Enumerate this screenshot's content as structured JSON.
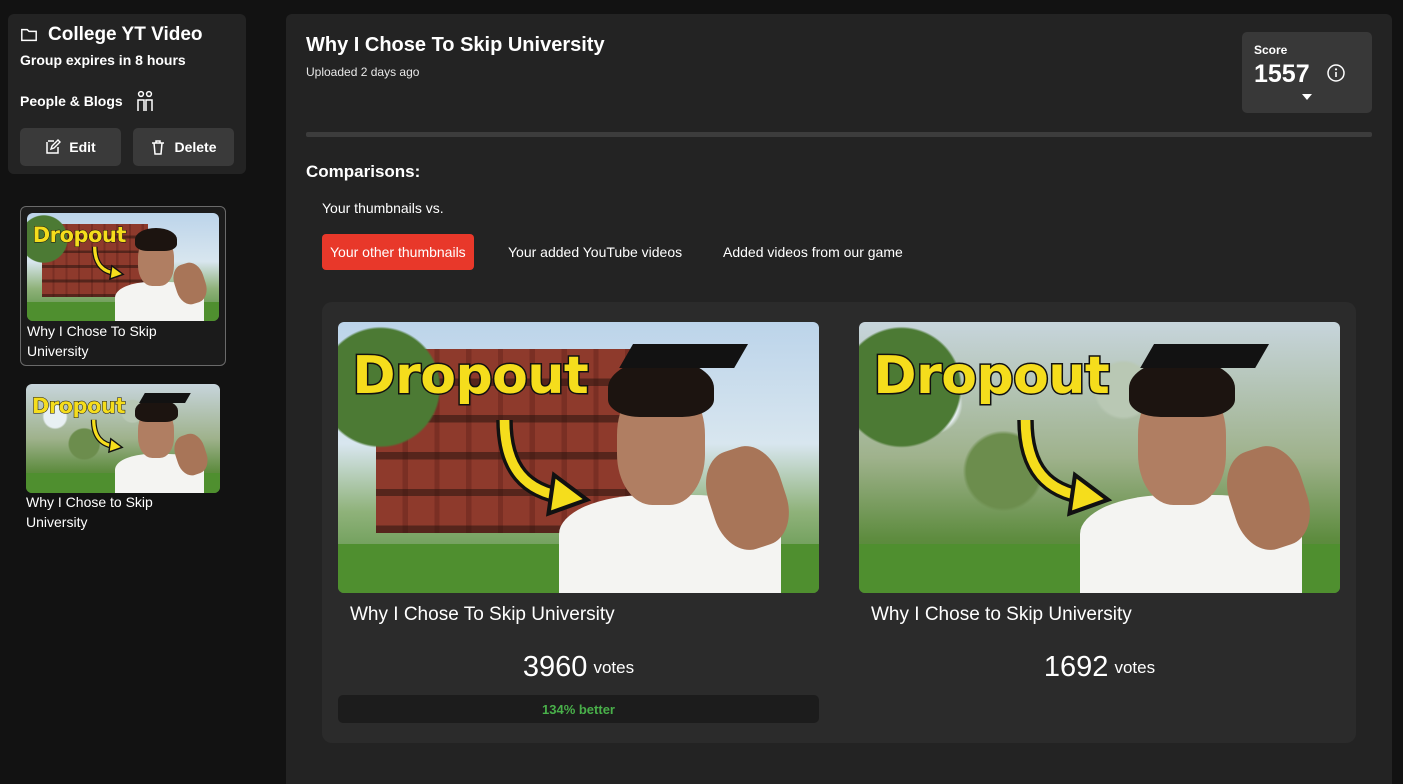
{
  "group": {
    "title": "College YT Video",
    "expiry": "Group expires in 8 hours",
    "category": "People & Blogs",
    "edit_label": "Edit",
    "delete_label": "Delete"
  },
  "sidebar_thumbnails": [
    {
      "word": "Dropout",
      "label": "Why I Chose To Skip University",
      "selected": true
    },
    {
      "word": "Dropout",
      "label": "Why I Chose to Skip University",
      "selected": false
    }
  ],
  "video": {
    "title": "Why I Chose To Skip University",
    "uploaded": "Uploaded 2 days ago"
  },
  "score": {
    "label": "Score",
    "value": "1557"
  },
  "comparisons": {
    "heading": "Comparisons:",
    "vs_label": "Your thumbnails vs.",
    "tabs": [
      {
        "label": "Your other thumbnails",
        "active": true
      },
      {
        "label": "Your added YouTube videos",
        "active": false
      },
      {
        "label": "Added videos from our game",
        "active": false
      }
    ]
  },
  "results": [
    {
      "word": "Dropout",
      "title": "Why I Chose To Skip University",
      "votes": "3960",
      "votes_label": "votes",
      "better": "134% better"
    },
    {
      "word": "Dropout",
      "title": "Why I Chose to Skip University",
      "votes": "1692",
      "votes_label": "votes"
    }
  ],
  "colors": {
    "accent": "#e8382a",
    "better_text": "#49b04a",
    "thumbnail_text": "#f5dd1c"
  }
}
